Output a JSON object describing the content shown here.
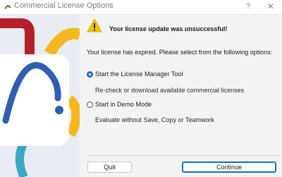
{
  "window": {
    "title": "Commercial License Options",
    "help_label": "?",
    "close_label": "✕"
  },
  "dialog": {
    "heading": "Your license update was unsuccessful!",
    "intro": "Your license has expired. Please select from the following options:",
    "options": [
      {
        "label": "Start the License Manager Tool",
        "description": "Re-check or download available commercial licenses",
        "selected": true
      },
      {
        "label": "Start in Demo Mode",
        "description": "Evaluate without Save, Copy or Teamwork",
        "selected": false
      }
    ]
  },
  "buttons": {
    "quit": "Quit",
    "continue": "Continue"
  },
  "colors": {
    "accent": "#1a6ec2",
    "warning": "#f5c400",
    "art_red": "#b3202a",
    "art_yellow": "#f5b820",
    "art_blue": "#2f5fb3",
    "art_teal": "#3aa7c4"
  },
  "icons": {
    "app": "app-logo-icon",
    "warning": "warning-icon"
  }
}
